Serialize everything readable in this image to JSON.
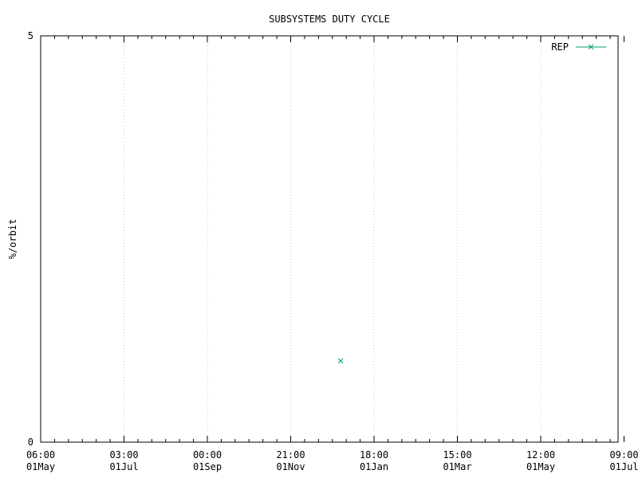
{
  "chart_data": {
    "type": "scatter",
    "title": "SUBSYSTEMS DUTY CYCLE",
    "xlabel": "",
    "ylabel": "%/orbit",
    "ylim": [
      0,
      5
    ],
    "yticks": [
      {
        "label": "0",
        "value": 0
      },
      {
        "label": "5",
        "value": 5
      }
    ],
    "xticks": [
      {
        "time": "06:00",
        "date": "01May"
      },
      {
        "time": "03:00",
        "date": "01Jul"
      },
      {
        "time": "00:00",
        "date": "01Sep"
      },
      {
        "time": "21:00",
        "date": "01Nov"
      },
      {
        "time": "18:00",
        "date": "01Jan"
      },
      {
        "time": "15:00",
        "date": "01Mar"
      },
      {
        "time": "12:00",
        "date": "01May"
      },
      {
        "time": "09:00",
        "date": "01Jul"
      }
    ],
    "grid": true,
    "legend_position": "top-right",
    "series": [
      {
        "name": "REP",
        "color": "#009e73",
        "marker": "x",
        "points": [
          {
            "x_tick_position": 3.6,
            "y": 1.0
          }
        ]
      }
    ]
  }
}
